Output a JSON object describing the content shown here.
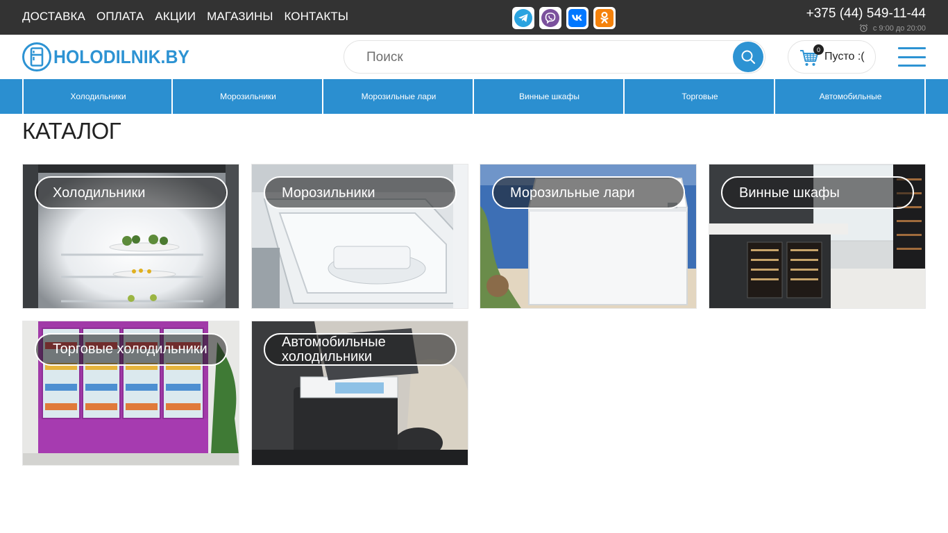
{
  "topbar": {
    "nav": [
      "ДОСТАВКА",
      "ОПЛАТА",
      "АКЦИИ",
      "МАГАЗИНЫ",
      "КОНТАКТЫ"
    ],
    "social": [
      "telegram-icon",
      "viber-icon",
      "vk-icon",
      "odnoklassniki-icon"
    ],
    "phone": "+375 (44) 549-11-44",
    "hours": "с 9:00 до 20:00"
  },
  "header": {
    "logo_text": "HOLODILNIK.BY",
    "search_placeholder": "Поиск",
    "cart_count": "0",
    "cart_label": "Пусто :("
  },
  "catnav": [
    "Холодильники",
    "Морозильники",
    "Морозильные лари",
    "Винные шкафы",
    "Торговые",
    "Автомобильные"
  ],
  "page_title": "КАТАЛОГ",
  "cards": [
    "Холодильники",
    "Морозильники",
    "Морозильные лари",
    "Винные шкафы",
    "Торговые холодильники",
    "Автомобильные холодильники"
  ],
  "colors": {
    "topbar": "#333333",
    "accent": "#2d93d3"
  }
}
